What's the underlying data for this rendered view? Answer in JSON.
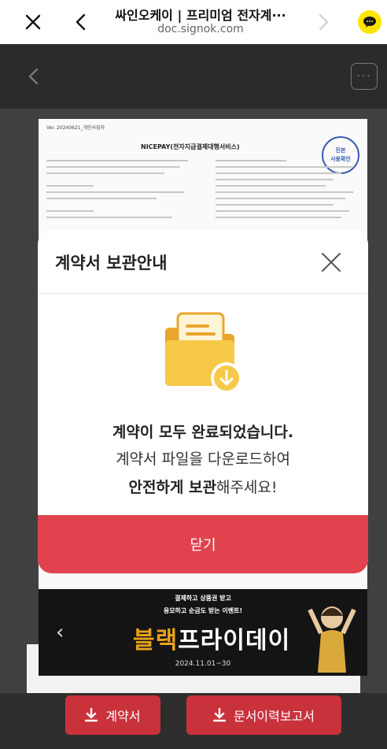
{
  "browser": {
    "title": "싸인오케이 | 프리미엄 전자계···",
    "url": "doc.signok.com"
  },
  "document": {
    "version": "Ver. 20240621_개인사업자",
    "heading": "NICEPAY(전자지급결제대행서비스)",
    "stamp_top": "진본",
    "stamp_bottom": "사용확인"
  },
  "banner": {
    "line1": "결제하고 상품권 받고",
    "line2": "응모하고 순금도 받는 이벤트!",
    "headline_highlight": "블랙",
    "headline_rest": "프라이데이",
    "date": "2024.11.01~30"
  },
  "modal": {
    "title": "계약서 보관안내",
    "message_bold": "계약이 모두 완료되었습니다.",
    "message_sub": "계약서 파일을 다운로드하여",
    "message_emphasis": "안전하게 보관",
    "message_end": "해주세요!",
    "close_button": "닫기"
  },
  "bottom": {
    "contract_button": "계약서",
    "history_button": "문서이력보고서"
  },
  "colors": {
    "accent_red": "#e0434e",
    "button_red": "#c9323b",
    "folder_yellow": "#f7c948",
    "kakao_yellow": "#fee500"
  }
}
